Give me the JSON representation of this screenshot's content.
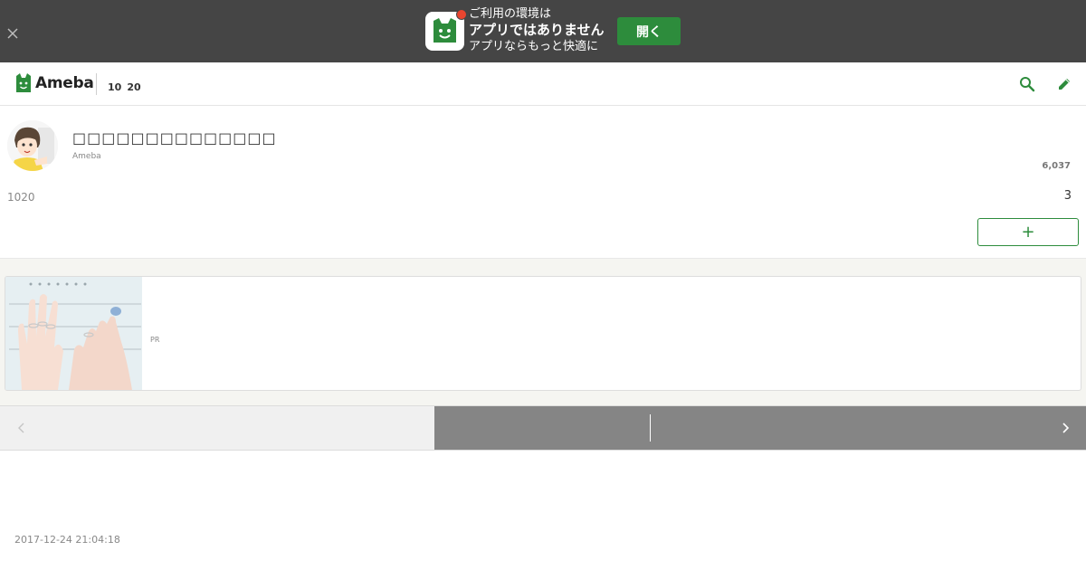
{
  "app_banner": {
    "line1": "ご利用の環境は",
    "line2": "アプリではありません",
    "line3": "アプリならもっと快適に",
    "open_label": "開く",
    "colors": {
      "background": "#454545",
      "button": "#2d8c3c",
      "dot": "#e8452f"
    }
  },
  "header": {
    "logo_text": "Ameba",
    "anniversary": [
      "10",
      "20"
    ],
    "icons": [
      "search-icon",
      "edit-icon"
    ],
    "accent_color": "#2d8c3c"
  },
  "profile": {
    "blog_title": "□□□□□□□□□□□□□□",
    "platform": "Ameba",
    "reader_count": "6,037",
    "number_left": "1020",
    "number_right": "3",
    "follow_label": "+"
  },
  "ad": {
    "label": "PR"
  },
  "pager": {
    "icons": [
      "chevron-left-icon",
      "chevron-right-icon"
    ]
  },
  "post": {
    "timestamp": "2017-12-24 21:04:18"
  }
}
